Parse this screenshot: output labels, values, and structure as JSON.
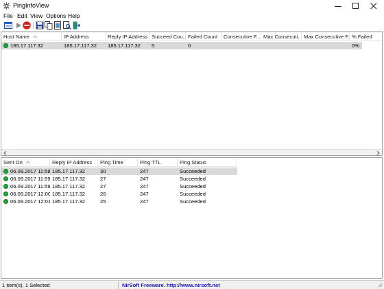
{
  "window": {
    "title": "PingInfoView"
  },
  "menu": [
    "File",
    "Edit",
    "View",
    "Options",
    "Help"
  ],
  "toolbar": {
    "icons": [
      "properties-icon",
      "start-icon",
      "stop-icon",
      "save-icon",
      "copy-icon",
      "html-report-icon",
      "find-icon",
      "exit-icon"
    ]
  },
  "hosts": {
    "columns": [
      "Host Name",
      "IP Address",
      "Reply IP Address",
      "Succeed Cou...",
      "Failed Count",
      "Consecutive F...",
      "Max Consecuti...",
      "Max Consecutive F...",
      "% Failed"
    ],
    "rows": [
      {
        "host": "185.17.117.32",
        "ip": "185.17.117.32",
        "reply_ip": "185.17.117.32",
        "succeed": "5",
        "failed": "0",
        "consec_failed": "",
        "max_consec": "",
        "max_consec_f": "",
        "pct_failed": "0%"
      }
    ]
  },
  "pings": {
    "columns": [
      "Sent On",
      "Reply IP Address",
      "Ping Time",
      "Ping TTL",
      "Ping Status"
    ],
    "rows": [
      {
        "sent": "06.09.2017 11:58:...",
        "reply_ip": "185.17.117.32",
        "time": "30",
        "ttl": "247",
        "status": "Succeeded"
      },
      {
        "sent": "06.09.2017 11:59:...",
        "reply_ip": "185.17.117.32",
        "time": "27",
        "ttl": "247",
        "status": "Succeeded"
      },
      {
        "sent": "06.09.2017 11:59:...",
        "reply_ip": "185.17.117.32",
        "time": "27",
        "ttl": "247",
        "status": "Succeeded"
      },
      {
        "sent": "06.09.2017 12:00:...",
        "reply_ip": "185.17.117.32",
        "time": "26",
        "ttl": "247",
        "status": "Succeeded"
      },
      {
        "sent": "06.09.2017 12:01:...",
        "reply_ip": "185.17.117.32",
        "time": "25",
        "ttl": "247",
        "status": "Succeeded"
      }
    ]
  },
  "status": {
    "items": "1 item(s), 1 Selected",
    "credit": "NirSoft Freeware.  http://www.nirsoft.net"
  },
  "colors": {
    "success": "#20a83a",
    "credit": "#1a1aa8",
    "selection": "#d9d9d9"
  }
}
